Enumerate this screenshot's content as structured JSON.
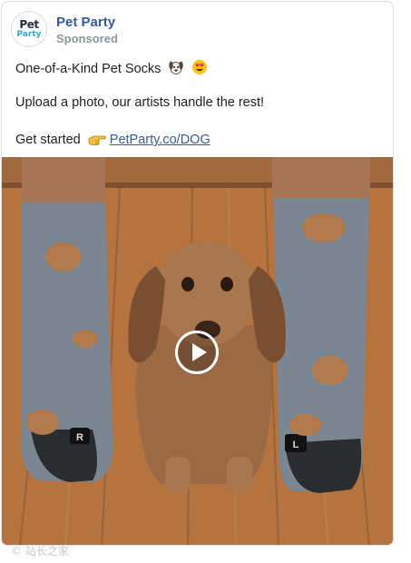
{
  "post": {
    "avatar_line1": "Pet",
    "avatar_line2": "Party",
    "page_name": "Pet Party",
    "sponsored": "Sponsored",
    "headline": "One-of-a-Kind Pet Socks",
    "headline_emojis": [
      "dog-face-icon",
      "heart-eyes-icon"
    ],
    "body": "Upload a photo, our artists handle the rest!",
    "cta_text": "Get started",
    "cta_icon": "pointing-hand-icon",
    "cta_link": "PetParty.co/DOG"
  },
  "media": {
    "description_icon": "play-button-icon",
    "sock_labels": [
      "R",
      "L"
    ]
  },
  "watermark": "© 站长之家",
  "colors": {
    "link": "#385898",
    "text": "#1c1e21",
    "secondary": "#90949c",
    "card_border": "#dcdee3"
  }
}
